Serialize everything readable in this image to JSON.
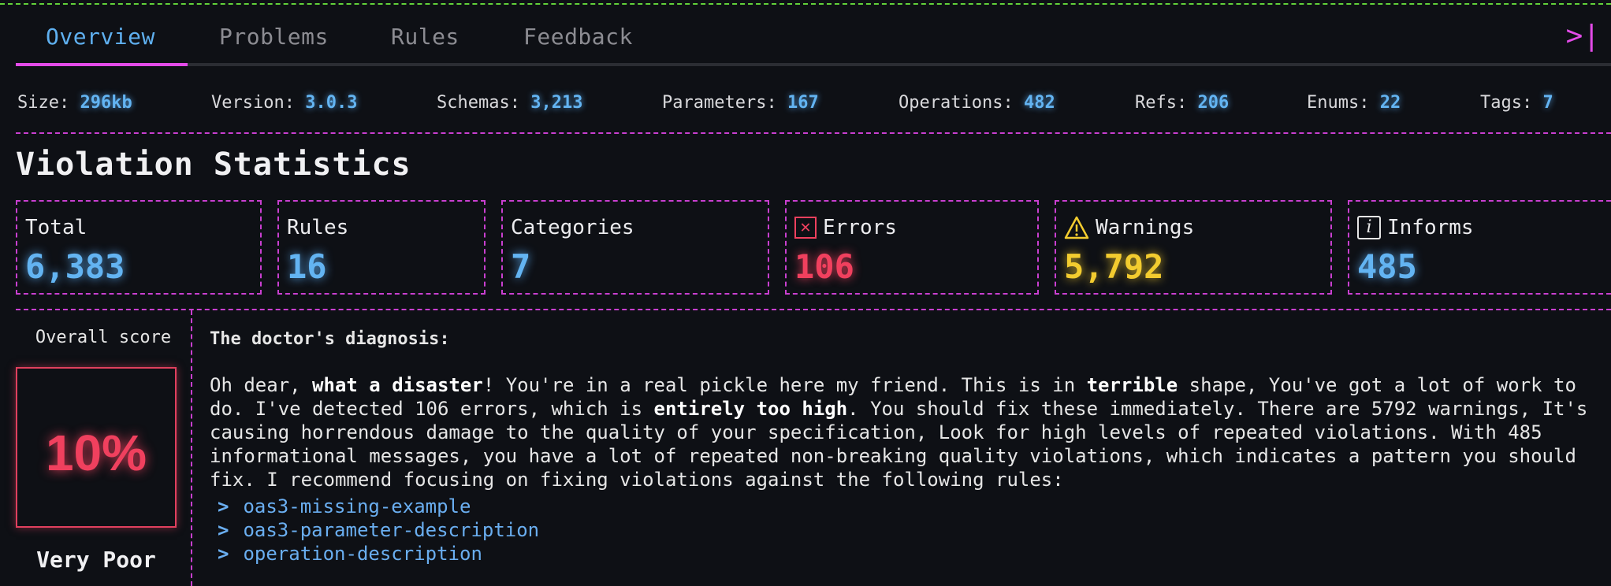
{
  "tabs": [
    {
      "label": "Overview",
      "active": true
    },
    {
      "label": "Problems",
      "active": false
    },
    {
      "label": "Rules",
      "active": false
    },
    {
      "label": "Feedback",
      "active": false
    }
  ],
  "collapse_icon": ">|",
  "stats": {
    "size": {
      "label": "Size:",
      "value": "296kb"
    },
    "version": {
      "label": "Version:",
      "value": "3.0.3"
    },
    "schemas": {
      "label": "Schemas:",
      "value": "3,213"
    },
    "parameters": {
      "label": "Parameters:",
      "value": "167"
    },
    "operations": {
      "label": "Operations:",
      "value": "482"
    },
    "refs": {
      "label": "Refs:",
      "value": "206"
    },
    "enums": {
      "label": "Enums:",
      "value": "22"
    },
    "tags": {
      "label": "Tags:",
      "value": "7"
    }
  },
  "section_title": "Violation Statistics",
  "cards": {
    "total": {
      "label": "Total",
      "value": "6,383"
    },
    "rules": {
      "label": "Rules",
      "value": "16"
    },
    "categories": {
      "label": "Categories",
      "value": "7"
    },
    "errors": {
      "label": "Errors",
      "value": "106",
      "icon": "x-box-icon"
    },
    "warnings": {
      "label": "Warnings",
      "value": "5,792",
      "icon": "warning-triangle-icon"
    },
    "informs": {
      "label": "Informs",
      "value": "485",
      "icon": "info-icon"
    }
  },
  "score": {
    "label": "Overall score",
    "value": "10%",
    "rating": "Very Poor"
  },
  "diagnosis": {
    "title": "The doctor's diagnosis:",
    "p1_a": "Oh dear, ",
    "p1_b": "what a disaster",
    "p1_c": "! You're in a real pickle here my friend. This is in ",
    "p1_d": "terrible",
    "p1_e": " shape, You've got a lot of work to do. I've detected 106 errors, which is ",
    "p1_f": "entirely too high",
    "p1_g": ". You should fix these immediately. There are 5792 warnings, It's causing horrendous damage to the quality of your specification, Look for high levels of repeated violations. With 485 informational messages, you have a lot of repeated non-breaking quality violations, which indicates a pattern you should fix. I recommend focusing on fixing violations against the following rules:",
    "rules": [
      "oas3-missing-example",
      "oas3-parameter-description",
      "operation-description"
    ]
  },
  "colors": {
    "accent": "#e34be8",
    "blue": "#63b4f2",
    "error": "#f0405e",
    "warning": "#f3cc2f",
    "background": "#0e1015"
  }
}
